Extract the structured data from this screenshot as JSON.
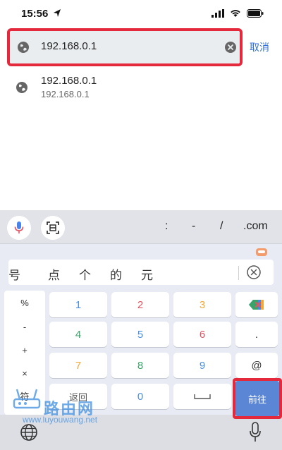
{
  "status_bar": {
    "time": "15:56"
  },
  "search": {
    "value": "192.168.0.1",
    "cancel_label": "取消"
  },
  "suggestions": [
    {
      "title": "192.168.0.1",
      "subtitle": "192.168.0.1"
    }
  ],
  "keyboard": {
    "toolbar_keys": [
      ":",
      "-",
      "/",
      ".com"
    ],
    "candidates": [
      "号",
      "点",
      "个",
      "的",
      "元"
    ],
    "symbols": [
      "%",
      "-",
      "+",
      "×",
      "符"
    ],
    "digits": [
      "1",
      "2",
      "3",
      "4",
      "5",
      "6",
      "7",
      "8",
      "9",
      "0"
    ],
    "side_keys": [
      ".",
      "@"
    ],
    "back_label": "返回",
    "go_label": "前往"
  },
  "watermark": {
    "chars": "路由网",
    "url": "www.luyouwang.net"
  },
  "colors": {
    "accent_blue": "#2f6fde",
    "highlight_red": "#e5293d",
    "go_key": "#5b86d6",
    "digit_1": "#4a90e2",
    "digit_2": "#e05563",
    "digit_3": "#f0a838",
    "digit_4": "#3aa36a",
    "digit_5": "#4a90e2",
    "digit_6": "#e05563",
    "digit_7": "#f0a838",
    "digit_8": "#3aa36a",
    "digit_9": "#4a90e2",
    "digit_0": "#4a90e2"
  }
}
